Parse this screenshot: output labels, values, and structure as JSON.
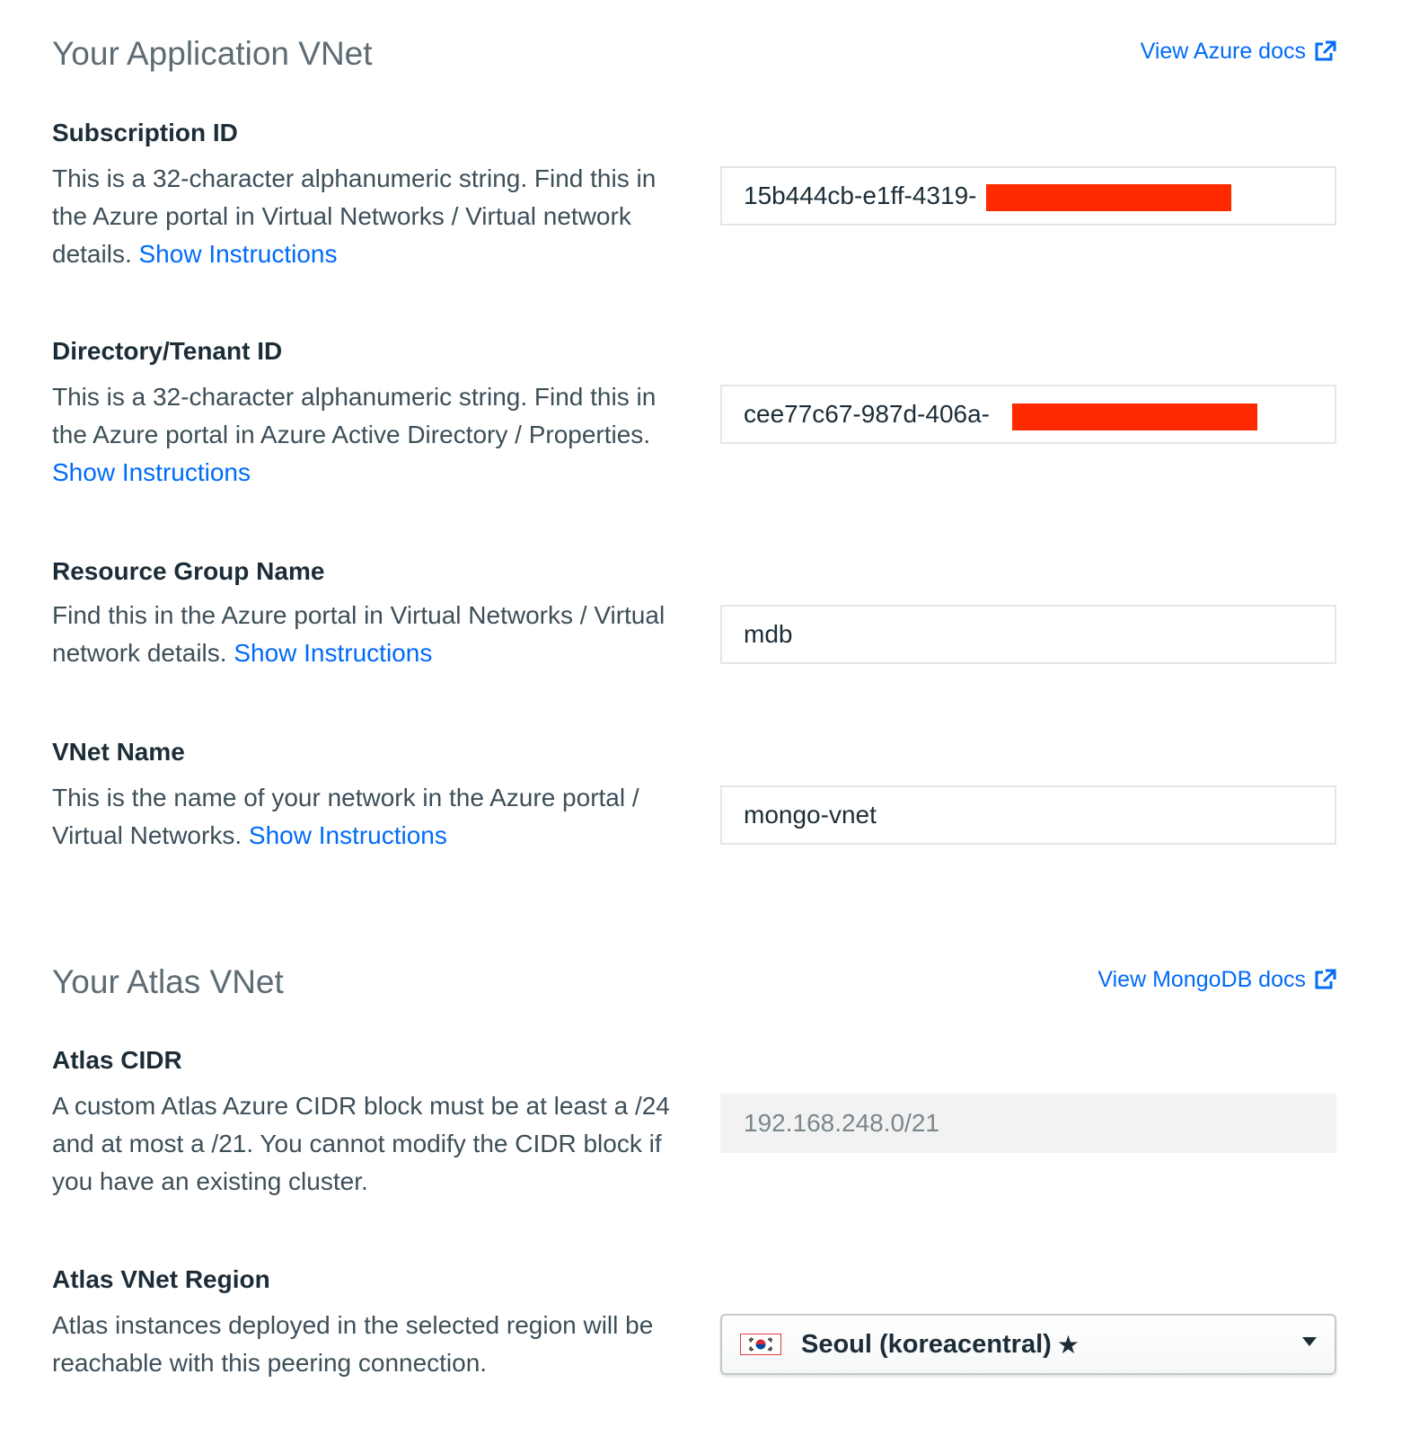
{
  "app_vnet": {
    "title": "Your Application VNet",
    "docs_link": "View Azure docs",
    "fields": [
      {
        "label": "Subscription ID",
        "description": "This is a 32-character alphanumeric string. Find this in the Azure portal in Virtual Networks / Virtual network details.",
        "link": "Show Instructions",
        "value": "15b444cb-e1ff-4319-"
      },
      {
        "label": "Directory/Tenant ID",
        "description": "This is a 32-character alphanumeric string. Find this in the Azure portal in Azure Active Directory / Properties.",
        "link": "Show Instructions",
        "value": "cee77c67-987d-406a-"
      },
      {
        "label": "Resource Group Name",
        "description": "Find this in the Azure portal in Virtual Networks / Virtual network details.",
        "link": "Show Instructions",
        "value": "mdb"
      },
      {
        "label": "VNet Name",
        "description": "This is the name of your network in the Azure portal / Virtual Networks.",
        "link": "Show Instructions",
        "value": "mongo-vnet"
      }
    ]
  },
  "atlas_vnet": {
    "title": "Your Atlas VNet",
    "docs_link": "View MongoDB docs",
    "cidr": {
      "label": "Atlas CIDR",
      "description": "A custom Atlas Azure CIDR block must be at least a /24 and at most a /21. You cannot modify the CIDR block if you have an existing cluster.",
      "value": "192.168.248.0/21"
    },
    "region": {
      "label": "Atlas VNet Region",
      "description": "Atlas instances deployed in the selected region will be reachable with this peering connection.",
      "selected": "Seoul (koreacentral)",
      "flag_icon": "south-korea-flag-icon",
      "star_icon": "star-icon"
    }
  },
  "colors": {
    "link": "#016bf8",
    "redaction": "#ff2a00"
  }
}
